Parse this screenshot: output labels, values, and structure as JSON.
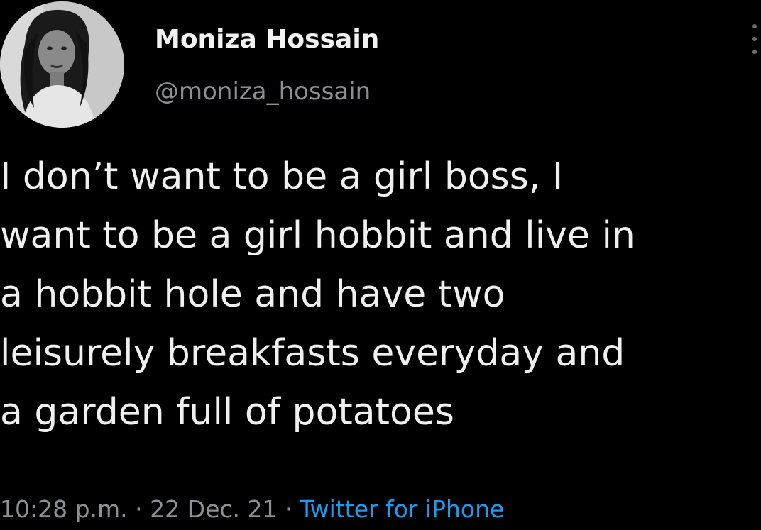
{
  "author": {
    "name": "Moniza Hossain",
    "handle": "@moniza_hossain",
    "avatar_icon": "profile-photo"
  },
  "tweet": {
    "lines": [
      "I don’t want to be a girl boss, I",
      "want to be a girl hobbit and live in",
      "a hobbit hole and have two",
      "leisurely breakfasts everyday and",
      "a garden full of potatoes"
    ]
  },
  "meta": {
    "time": "10:28 p.m.",
    "separator": "·",
    "date": "22 Dec. 21",
    "source": "Twitter for iPhone"
  },
  "colors": {
    "background": "#000000",
    "text": "#f0f0f0",
    "secondary_text": "#8b9096",
    "link": "#1d9bf0"
  },
  "more_icon": "more-options-icon"
}
